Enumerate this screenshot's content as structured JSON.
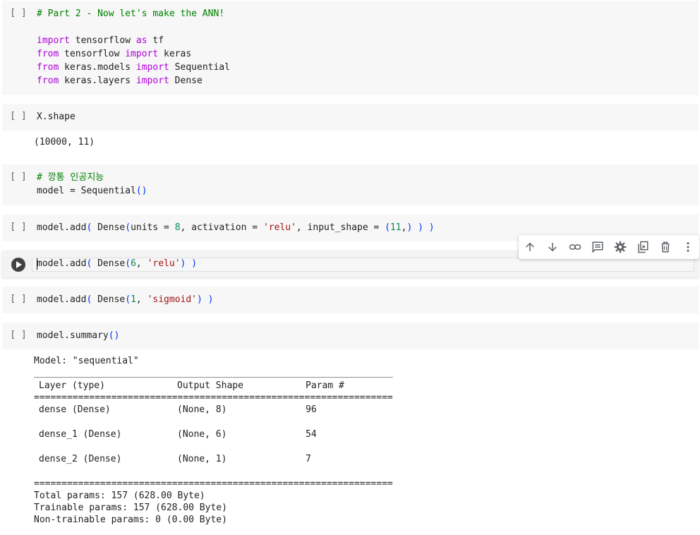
{
  "run_marker": "[ ]",
  "cells": [
    {
      "id": "part2-imports",
      "lines": [
        [
          {
            "t": "# Part 2 - Now let's make the ANN!",
            "c": "cm"
          }
        ],
        [],
        [
          {
            "t": "import",
            "c": "kw"
          },
          {
            "t": " tensorflow ",
            "c": "fn"
          },
          {
            "t": "as",
            "c": "kw"
          },
          {
            "t": " tf",
            "c": "fn"
          }
        ],
        [
          {
            "t": "from",
            "c": "kw"
          },
          {
            "t": " tensorflow ",
            "c": "fn"
          },
          {
            "t": "import",
            "c": "kw"
          },
          {
            "t": " keras",
            "c": "fn"
          }
        ],
        [
          {
            "t": "from",
            "c": "kw"
          },
          {
            "t": " keras.models ",
            "c": "fn"
          },
          {
            "t": "import",
            "c": "kw"
          },
          {
            "t": " Sequential",
            "c": "fn"
          }
        ],
        [
          {
            "t": "from",
            "c": "kw"
          },
          {
            "t": " keras.layers ",
            "c": "fn"
          },
          {
            "t": "import",
            "c": "kw"
          },
          {
            "t": " Dense",
            "c": "fn"
          }
        ]
      ]
    },
    {
      "id": "x-shape",
      "lines": [
        [
          {
            "t": "X.shape",
            "c": "fn"
          }
        ]
      ],
      "output": [
        "(10000, 11)"
      ]
    },
    {
      "id": "model-create",
      "lines": [
        [
          {
            "t": "# 깡통 인공지능",
            "c": "cm"
          }
        ],
        [
          {
            "t": "model = Sequential",
            "c": "fn"
          },
          {
            "t": "()",
            "c": "par"
          }
        ]
      ]
    },
    {
      "id": "add-dense-8",
      "lines": [
        [
          {
            "t": "model.add",
            "c": "fn"
          },
          {
            "t": "(",
            "c": "par"
          },
          {
            "t": " Dense",
            "c": "fn"
          },
          {
            "t": "(",
            "c": "par"
          },
          {
            "t": "units = ",
            "c": "fn"
          },
          {
            "t": "8",
            "c": "num"
          },
          {
            "t": ", activation = ",
            "c": "fn"
          },
          {
            "t": "'relu'",
            "c": "str"
          },
          {
            "t": ", input_shape = ",
            "c": "fn"
          },
          {
            "t": "(",
            "c": "par"
          },
          {
            "t": "11",
            "c": "num"
          },
          {
            "t": ",",
            "c": "fn"
          },
          {
            "t": ")",
            "c": "par"
          },
          {
            "t": " ",
            "c": "fn"
          },
          {
            "t": ")",
            "c": "par"
          },
          {
            "t": " ",
            "c": "fn"
          },
          {
            "t": ")",
            "c": "par"
          }
        ]
      ]
    },
    {
      "id": "add-dense-6",
      "active": true,
      "lines": [
        [
          {
            "t": "model.add",
            "c": "fn"
          },
          {
            "t": "(",
            "c": "par"
          },
          {
            "t": " Dense",
            "c": "fn"
          },
          {
            "t": "(",
            "c": "par"
          },
          {
            "t": "6",
            "c": "num"
          },
          {
            "t": ", ",
            "c": "fn"
          },
          {
            "t": "'relu'",
            "c": "str"
          },
          {
            "t": ")",
            "c": "par"
          },
          {
            "t": " ",
            "c": "fn"
          },
          {
            "t": ")",
            "c": "par"
          }
        ]
      ]
    },
    {
      "id": "add-dense-1",
      "lines": [
        [
          {
            "t": "model.add",
            "c": "fn"
          },
          {
            "t": "(",
            "c": "par"
          },
          {
            "t": " Dense",
            "c": "fn"
          },
          {
            "t": "(",
            "c": "par"
          },
          {
            "t": "1",
            "c": "num"
          },
          {
            "t": ", ",
            "c": "fn"
          },
          {
            "t": "'sigmoid'",
            "c": "str"
          },
          {
            "t": ")",
            "c": "par"
          },
          {
            "t": " ",
            "c": "fn"
          },
          {
            "t": ")",
            "c": "par"
          }
        ]
      ]
    },
    {
      "id": "model-summary",
      "lines": [
        [
          {
            "t": "model.summary",
            "c": "fn"
          },
          {
            "t": "()",
            "c": "par"
          }
        ]
      ]
    }
  ],
  "summary": {
    "model_line": "Model: \"sequential\"",
    "rule_single": "_________________________________________________________________",
    "rule_double": "=================================================================",
    "headers": [
      "Layer (type)",
      "Output Shape",
      "Param #"
    ],
    "rows": [
      [
        "dense (Dense)",
        "(None, 8)",
        "96"
      ],
      [
        "dense_1 (Dense)",
        "(None, 6)",
        "54"
      ],
      [
        "dense_2 (Dense)",
        "(None, 1)",
        "7"
      ]
    ],
    "total": "Total params: 157 (628.00 Byte)",
    "trainable": "Trainable params: 157 (628.00 Byte)",
    "non_trainable": "Non-trainable params: 0 (0.00 Byte)"
  },
  "toolbar": {
    "icons": [
      "arrow-up-icon",
      "arrow-down-icon",
      "link-icon",
      "comment-icon",
      "gear-icon",
      "mirror-cell-icon",
      "trash-icon",
      "more-vert-icon"
    ]
  }
}
